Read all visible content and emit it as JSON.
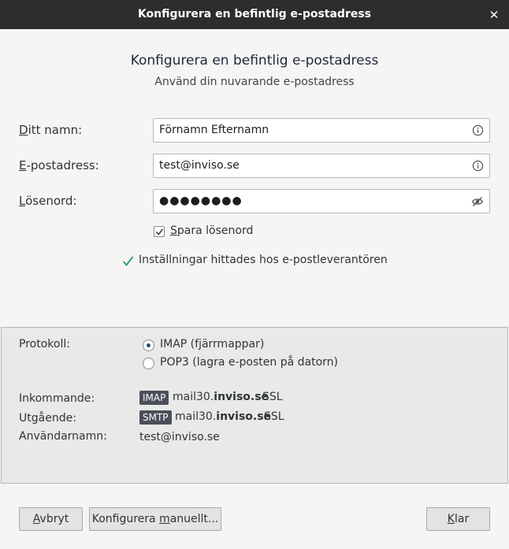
{
  "window": {
    "title": "Konfigurera en befintlig e-postadress",
    "close_glyph": "✕"
  },
  "header": {
    "title": "Konfigurera en befintlig e-postadress",
    "subtitle": "Använd din nuvarande e-postadress"
  },
  "form": {
    "name": {
      "label_ul": "D",
      "label_rest": "itt namn:",
      "value": "Förnamn Efternamn"
    },
    "email": {
      "label_ul": "E",
      "label_rest": "-postadress:",
      "value": "test@inviso.se"
    },
    "password": {
      "label_ul": "L",
      "label_rest": "ösenord:",
      "value": "●●●●●●●●"
    },
    "remember": {
      "label_ul": "S",
      "label_rest": "para lösenord",
      "checked": true
    }
  },
  "status": {
    "text": "Inställningar hittades hos e-postleverantören",
    "color": "#26a269"
  },
  "panel": {
    "protocol_label": "Protokoll:",
    "options": [
      {
        "label": "IMAP (fjärrmappar)",
        "selected": true
      },
      {
        "label": "POP3 (lagra e-posten på datorn)",
        "selected": false
      }
    ],
    "incoming_label": "Inkommande:",
    "incoming": {
      "badge": "IMAP",
      "host_prefix": "mail30.",
      "host_domain": "inviso.se",
      "security": "SSL"
    },
    "outgoing_label": "Utgående:",
    "outgoing": {
      "badge": "SMTP",
      "host_prefix": "mail30.",
      "host_domain": "inviso.se",
      "security": "SSL"
    },
    "username_label": "Användarnamn:",
    "username": "test@inviso.se"
  },
  "buttons": {
    "cancel": {
      "ul": "A",
      "rest": "vbryt"
    },
    "manual": {
      "pre": "Konfigurera ",
      "ul": "m",
      "rest": "anuellt..."
    },
    "done": {
      "ul": "K",
      "rest": "lar"
    }
  }
}
